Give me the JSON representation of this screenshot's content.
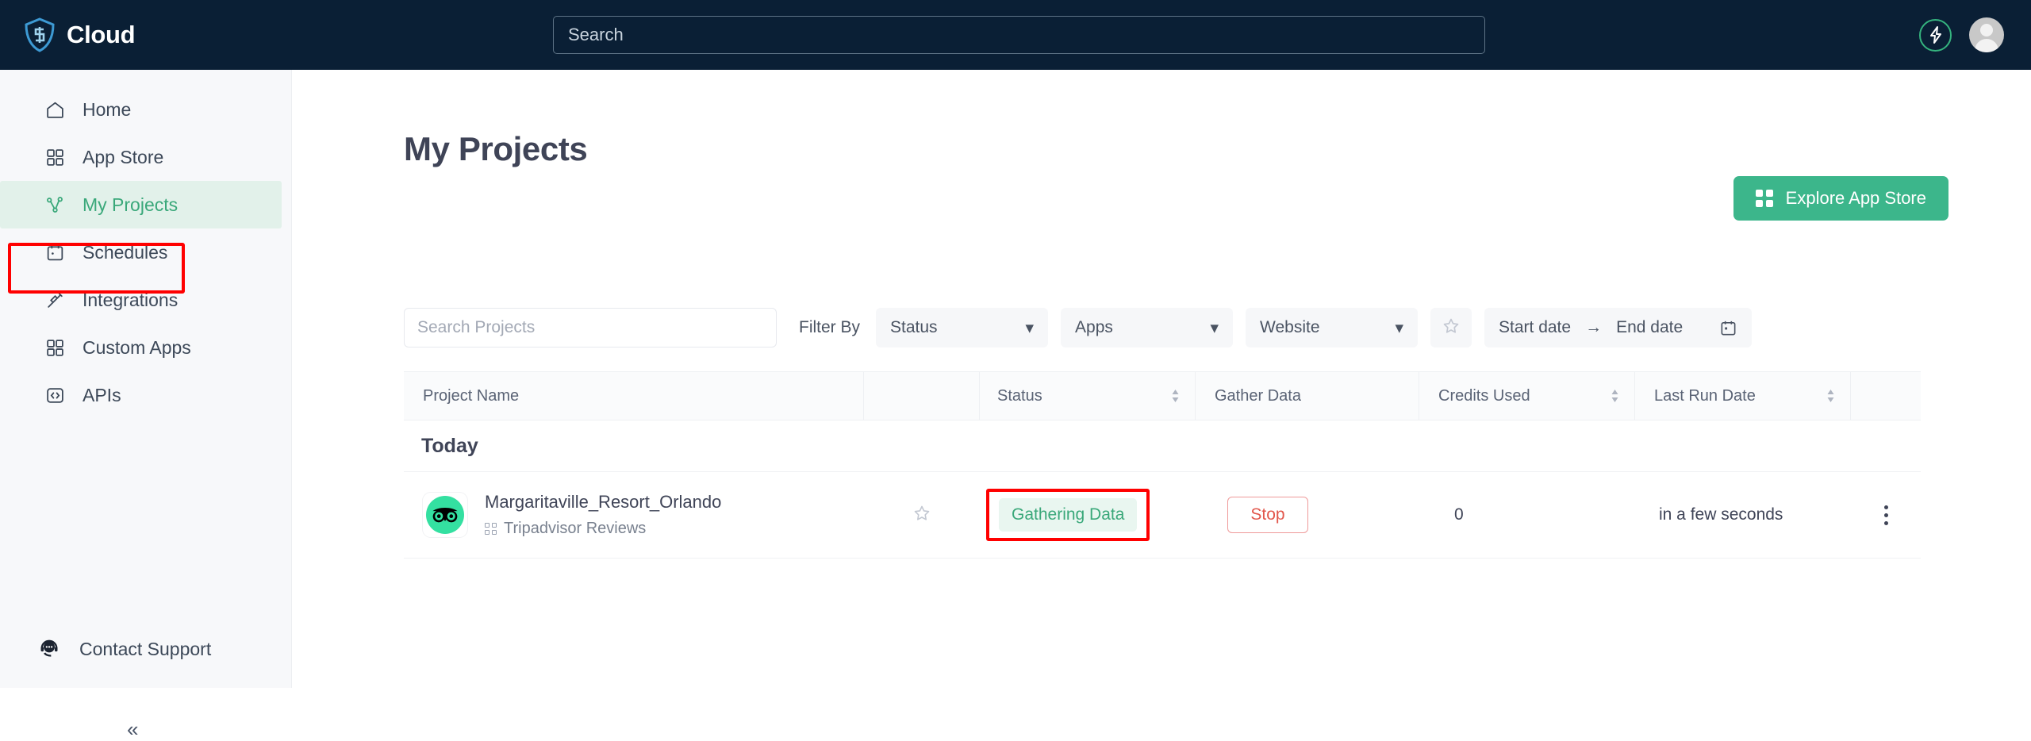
{
  "brand": {
    "name": "Cloud",
    "logo_icon": "shield-logo-icon"
  },
  "topnav": {
    "search_placeholder": "Search",
    "credits_icon": "lightning-bolt-icon",
    "avatar_icon": "user-avatar-icon"
  },
  "sidebar": {
    "items": [
      {
        "label": "Home",
        "icon": "home-icon",
        "active": false
      },
      {
        "label": "App Store",
        "icon": "grid-icon",
        "active": false
      },
      {
        "label": "My Projects",
        "icon": "workflow-icon",
        "active": true
      },
      {
        "label": "Schedules",
        "icon": "calendar-icon",
        "active": false
      },
      {
        "label": "Integrations",
        "icon": "plug-icon",
        "active": false
      },
      {
        "label": "Custom Apps",
        "icon": "grid-icon",
        "active": false
      },
      {
        "label": "APIs",
        "icon": "code-brackets-icon",
        "active": false
      }
    ],
    "support": {
      "label": "Contact Support",
      "icon": "headset-chat-icon"
    },
    "collapse": {
      "icon": "double-chevron-left-icon",
      "glyph": "«"
    }
  },
  "main": {
    "page_title": "My Projects",
    "explore_button": {
      "label": "Explore App Store",
      "icon": "grid-icon"
    },
    "filters": {
      "search_placeholder": "Search Projects",
      "filter_by_label": "Filter By",
      "selects": [
        {
          "name": "status",
          "value": "Status"
        },
        {
          "name": "apps",
          "value": "Apps"
        },
        {
          "name": "website",
          "value": "Website"
        }
      ],
      "favorite_icon": "star-outline-icon",
      "date_range": {
        "start_placeholder": "Start date",
        "separator": "→",
        "end_placeholder": "End date",
        "calendar_icon": "calendar-icon"
      }
    },
    "table": {
      "columns": [
        {
          "key": "name",
          "label": "Project Name",
          "sortable": false
        },
        {
          "key": "fav",
          "label": "",
          "sortable": false
        },
        {
          "key": "status",
          "label": "Status",
          "sortable": true
        },
        {
          "key": "gather",
          "label": "Gather Data",
          "sortable": false
        },
        {
          "key": "credits",
          "label": "Credits Used",
          "sortable": true
        },
        {
          "key": "lastrun",
          "label": "Last Run Date",
          "sortable": true
        }
      ],
      "groups": [
        {
          "label": "Today",
          "rows": [
            {
              "app_icon": "tripadvisor-owl-icon",
              "project_name": "Margaritaville_Resort_Orlando",
              "app_name": "Tripadvisor Reviews",
              "favorite_icon": "star-outline-icon",
              "status": "Gathering Data",
              "status_highlighted": true,
              "gather_action": "Stop",
              "credits_used": "0",
              "last_run_date": "in a few seconds",
              "menu_icon": "kebab-menu-icon"
            }
          ]
        }
      ]
    }
  },
  "colors": {
    "navbar_bg": "#0a1f35",
    "sidebar_bg": "#f7f8fa",
    "accent_green": "#3cb68b",
    "active_green_bg": "#e2f1ea",
    "active_green_text": "#3aa87a",
    "highlight_red": "#ff0000",
    "stop_red": "#e2574c",
    "tripadvisor_green": "#34e0a1"
  }
}
